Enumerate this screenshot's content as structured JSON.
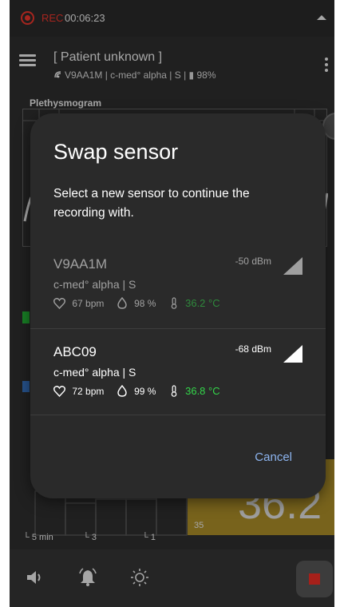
{
  "status_bar": {
    "rec_label": "REC",
    "rec_time": "00:06:23",
    "rec_color": "#ff3a2f"
  },
  "header": {
    "patient_name": "[ Patient unknown ]",
    "sensor_info": "V9AA1M | c-med° alpha | S | ▮ 98%"
  },
  "background": {
    "pleth_label": "Plethysmogram",
    "temp_value": "36.2",
    "scale_35": "35",
    "axis_labels": [
      "5 min",
      "3",
      "1"
    ],
    "accent_color": "#b9982c"
  },
  "dialog": {
    "title": "Swap sensor",
    "message": "Select a  new sensor to continue the recording with.",
    "cancel_label": "Cancel",
    "sensors": [
      {
        "name": "V9AA1M",
        "rssi": "-50 dBm",
        "model": "c-med° alpha | S",
        "heart_rate": "67 bpm",
        "spo2": "98 %",
        "temperature": "36.2 °C",
        "enabled": false
      },
      {
        "name": "ABC09",
        "rssi": "-68 dBm",
        "model": "c-med° alpha | S",
        "heart_rate": "72 bpm",
        "spo2": "99 %",
        "temperature": "36.8 °C",
        "enabled": true
      }
    ]
  },
  "bottom_bar": {
    "icons": [
      "volume-icon",
      "alarm-bell-icon",
      "brightness-icon",
      "stop-recording-icon"
    ],
    "stop_color": "#ff3228"
  }
}
